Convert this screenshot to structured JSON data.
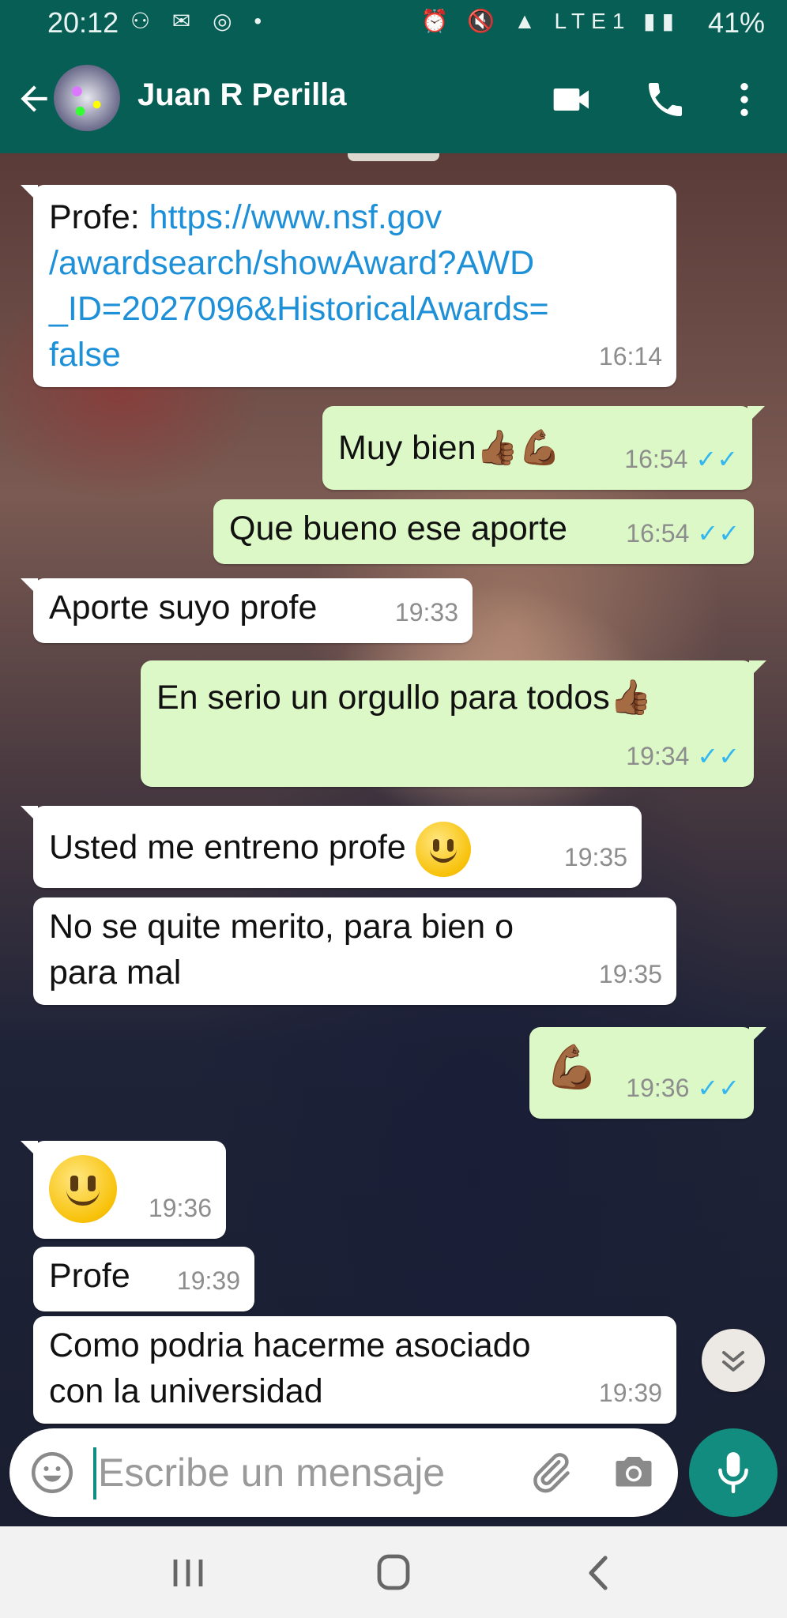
{
  "status_bar": {
    "time": "20:12",
    "left_icons": "⚇ ✉ ◎ •",
    "right_icons": "⏰ 🔇 ▲ LTE1 ▮▮",
    "battery": "41%"
  },
  "header": {
    "contact_name": "Juan R Perilla"
  },
  "messages": [
    {
      "direction": "in",
      "text_prefix": "Profe: ",
      "link": "https://www.nsf.gov\n/awardsearch/showAward?AWD\n_ID=2027096&HistoricalAwards=\nfalse",
      "time": "16:14"
    },
    {
      "direction": "out",
      "text": "Muy bien",
      "emojis": "👍🏾💪🏾",
      "time": "16:54",
      "ticks": "✓✓"
    },
    {
      "direction": "out",
      "text": "Que bueno ese aporte",
      "time": "16:54",
      "ticks": "✓✓"
    },
    {
      "direction": "in",
      "text": "Aporte suyo profe",
      "time": "19:33"
    },
    {
      "direction": "out",
      "text": "En serio un orgullo para todos",
      "emojis": "👍🏾",
      "time": "19:34",
      "ticks": "✓✓"
    },
    {
      "direction": "in",
      "text": "Usted me entreno profe",
      "emojis": "smile",
      "time": "19:35"
    },
    {
      "direction": "in",
      "text": "No se quite merito, para bien o\npara mal",
      "time": "19:35"
    },
    {
      "direction": "out",
      "text": "",
      "emojis": "💪🏾",
      "time": "19:36",
      "ticks": "✓✓"
    },
    {
      "direction": "in",
      "text": "",
      "emojis": "smile",
      "time": "19:36"
    },
    {
      "direction": "in",
      "text": "Profe",
      "time": "19:39"
    },
    {
      "direction": "in",
      "text": "Como podria hacerme asociado\ncon la universidad",
      "time": "19:39"
    }
  ],
  "composer": {
    "placeholder": "Escribe un mensaje"
  },
  "colors": {
    "header": "#075e54",
    "outgoing_bubble": "#dcf8c6",
    "incoming_bubble": "#ffffff",
    "link": "#1e90d8",
    "read_ticks": "#34b7f1",
    "accent": "#128c7e"
  }
}
